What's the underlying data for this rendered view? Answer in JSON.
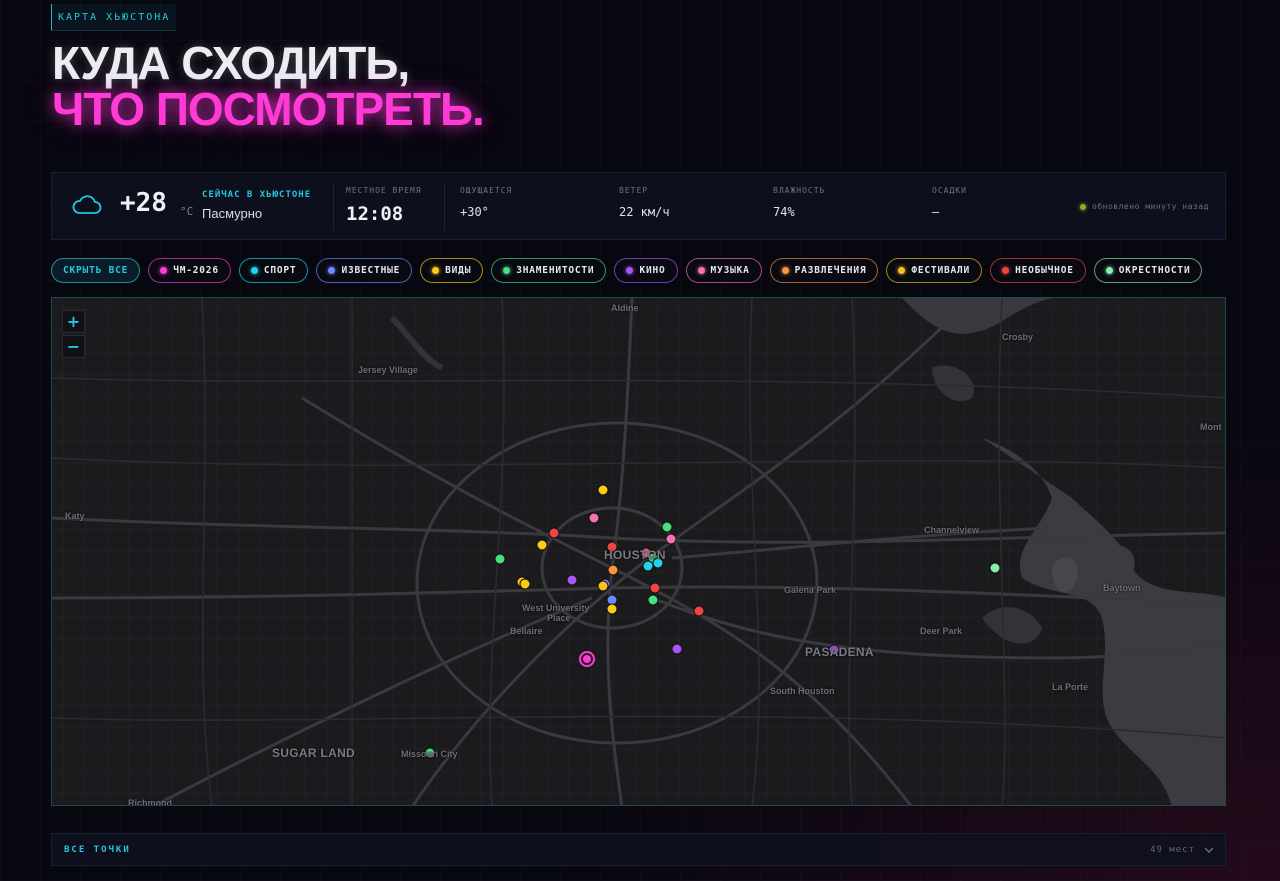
{
  "header": {
    "eyebrow": "КАРТА ХЬЮСТОНА",
    "title_line1": "КУДА СХОДИТЬ,",
    "title_line2": "ЧТО ПОСМОТРЕТЬ."
  },
  "weather": {
    "icon": "cloud-icon",
    "temp": "+28",
    "unit": "°C",
    "now_label": "СЕЙЧАС В ХЬЮСТОНЕ",
    "condition": "Пасмурно",
    "time_label": "МЕСТНОЕ ВРЕМЯ",
    "time": "12:08",
    "feels_label": "ОЩУЩАЕТСЯ",
    "feels": "+30°",
    "wind_label": "ВЕТЕР",
    "wind": "22 км/ч",
    "humidity_label": "ВЛАЖНОСТЬ",
    "humidity": "74%",
    "precip_label": "ОСАДКИ",
    "precip": "—",
    "updated": "обновлено минуту назад"
  },
  "filters": {
    "hide_all": "СКРЫТЬ ВСЕ",
    "items": [
      {
        "label": "ЧМ-2026",
        "color": "#ff3ad6"
      },
      {
        "label": "СПОРТ",
        "color": "#22d3ee"
      },
      {
        "label": "ИЗВЕСТНЫЕ",
        "color": "#6b8cff"
      },
      {
        "label": "ВИДЫ",
        "color": "#facc15"
      },
      {
        "label": "ЗНАМЕНИТОСТИ",
        "color": "#4ade80"
      },
      {
        "label": "КИНО",
        "color": "#a855f7"
      },
      {
        "label": "МУЗЫКА",
        "color": "#f472b6"
      },
      {
        "label": "РАЗВЛЕЧЕНИЯ",
        "color": "#fb923c"
      },
      {
        "label": "ФЕСТИВАЛИ",
        "color": "#fbbf24"
      },
      {
        "label": "НЕОБЫЧНОЕ",
        "color": "#ef4444"
      },
      {
        "label": "ОКРЕСТНОСТИ",
        "color": "#86efac"
      }
    ]
  },
  "map": {
    "zoom_in": "+",
    "zoom_out": "−",
    "places": {
      "aldine": "Aldine",
      "crosby": "Crosby",
      "jersey": "Jersey Village",
      "katy": "Katy",
      "houston": "HOUSTON",
      "channelview": "Channelview",
      "galena": "Galena Park",
      "baytown": "Baytown",
      "mont": "Mont",
      "westu": "West University",
      "place": "Place",
      "bellaire": "Bellaire",
      "deerpark": "Deer Park",
      "pasadena": "PASADENA",
      "southhouston": "South Houston",
      "laporte": "La Porte",
      "sugarland": "SUGAR LAND",
      "missouri": "Missouri City",
      "richmond": "Richmond"
    }
  },
  "points": {
    "label": "ВСЕ ТОЧКИ",
    "count": "49 мест"
  }
}
